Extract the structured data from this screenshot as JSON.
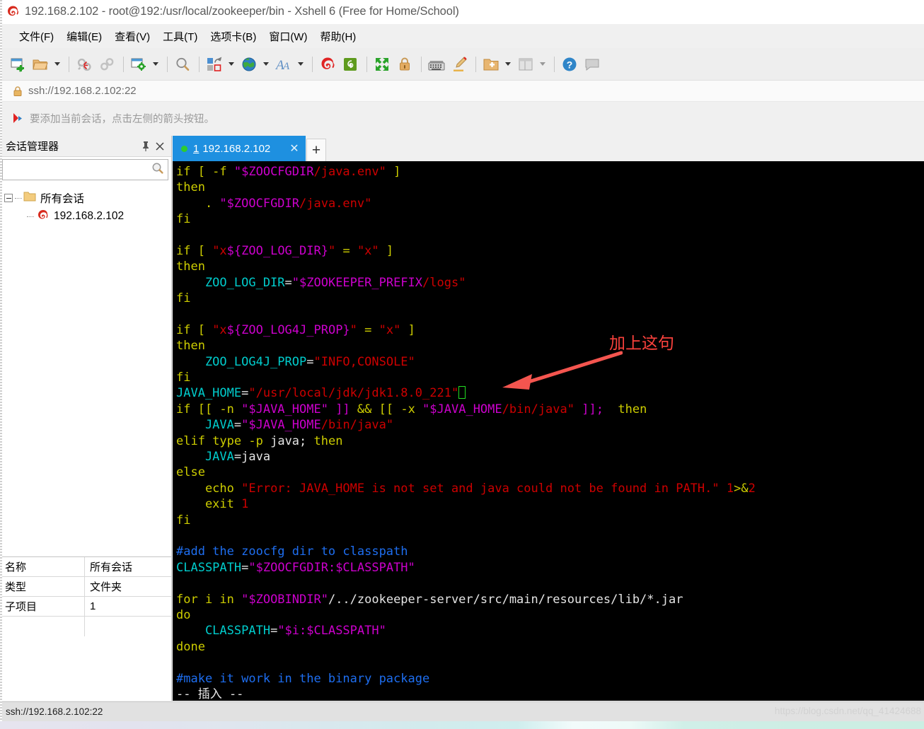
{
  "window": {
    "title": "192.168.2.102 - root@192:/usr/local/zookeeper/bin - Xshell 6 (Free for Home/School)",
    "app_icon": "xshell-logo-icon"
  },
  "menubar": {
    "items": [
      {
        "label": "文件(F)",
        "name": "menu-file"
      },
      {
        "label": "编辑(E)",
        "name": "menu-edit"
      },
      {
        "label": "查看(V)",
        "name": "menu-view"
      },
      {
        "label": "工具(T)",
        "name": "menu-tools"
      },
      {
        "label": "选项卡(B)",
        "name": "menu-tabs"
      },
      {
        "label": "窗口(W)",
        "name": "menu-window"
      },
      {
        "label": "帮助(H)",
        "name": "menu-help"
      }
    ]
  },
  "toolbar": {
    "buttons": [
      {
        "icon": "new-session-icon",
        "caret": false
      },
      {
        "icon": "open-folder-icon",
        "caret": true
      },
      {
        "sep": true
      },
      {
        "icon": "disconnect-icon",
        "caret": false
      },
      {
        "icon": "reconnect-link-icon",
        "caret": false
      },
      {
        "sep": true
      },
      {
        "icon": "session-properties-icon",
        "caret": true
      },
      {
        "sep": true
      },
      {
        "icon": "find-icon",
        "caret": false
      },
      {
        "sep": true
      },
      {
        "icon": "layout-arrange-icon",
        "caret": true
      },
      {
        "icon": "globe-icon",
        "caret": true
      },
      {
        "icon": "font-icon",
        "caret": true
      },
      {
        "sep": true
      },
      {
        "icon": "xshell-icon",
        "caret": false
      },
      {
        "icon": "xftp-icon",
        "caret": false
      },
      {
        "sep": true
      },
      {
        "icon": "fullscreen-icon",
        "caret": false
      },
      {
        "icon": "lock-icon",
        "caret": false
      },
      {
        "sep": true
      },
      {
        "icon": "keyboard-icon",
        "caret": false
      },
      {
        "icon": "highlight-pen-icon",
        "caret": false
      },
      {
        "sep": true
      },
      {
        "icon": "add-to-folder-icon",
        "caret": true
      },
      {
        "icon": "split-view-icon",
        "caret": true
      },
      {
        "sep": true
      },
      {
        "icon": "help-icon",
        "caret": false
      },
      {
        "icon": "comment-icon",
        "caret": false
      }
    ]
  },
  "addressbar": {
    "lock_icon": "padlock-icon",
    "url": "ssh://192.168.2.102:22"
  },
  "notice": {
    "icon": "red-arrow-flag-icon",
    "text": "要添加当前会话，点击左侧的箭头按钮。"
  },
  "sidebar": {
    "title": "会话管理器",
    "pin_icon": "pin-icon",
    "close_icon": "close-icon",
    "search": {
      "value": "",
      "placeholder": "",
      "icon": "search-icon"
    },
    "tree": {
      "root": {
        "label": "所有会话",
        "icon": "folder-icon",
        "expanded": true
      },
      "children": [
        {
          "label": "192.168.2.102",
          "icon": "xshell-session-icon"
        }
      ]
    },
    "properties": [
      {
        "key": "名称",
        "value": "所有会话"
      },
      {
        "key": "类型",
        "value": "文件夹"
      },
      {
        "key": "子项目",
        "value": "1"
      }
    ]
  },
  "tabs": {
    "items": [
      {
        "number": "1",
        "label": "192.168.2.102",
        "status_dot_color": "#2ecc2e",
        "close_label": "✕",
        "active": true
      }
    ],
    "new_tab_label": "+"
  },
  "terminal": {
    "mode_line": "-- 插入 --",
    "cursor": {
      "visible": true,
      "line_index": 15,
      "style": "green-box-outline"
    },
    "lines": [
      {
        "tokens": [
          {
            "t": "if [ -f ",
            "c": "yellow"
          },
          {
            "t": "\"$ZOOCFGDIR",
            "c": "magenta"
          },
          {
            "t": "/java.env\"",
            "c": "red"
          },
          {
            "t": " ]",
            "c": "yellow"
          }
        ]
      },
      {
        "tokens": [
          {
            "t": "then",
            "c": "yellow"
          }
        ]
      },
      {
        "tokens": [
          {
            "t": "    . ",
            "c": "yellow"
          },
          {
            "t": "\"$ZOOCFGDIR",
            "c": "magenta"
          },
          {
            "t": "/java.env\"",
            "c": "red"
          }
        ]
      },
      {
        "tokens": [
          {
            "t": "fi",
            "c": "yellow"
          }
        ]
      },
      {
        "tokens": [
          {
            "t": "",
            "c": "yellow"
          }
        ]
      },
      {
        "tokens": [
          {
            "t": "if [ ",
            "c": "yellow"
          },
          {
            "t": "\"x",
            "c": "red"
          },
          {
            "t": "${ZOO_LOG_DIR}",
            "c": "magenta"
          },
          {
            "t": "\"",
            "c": "red"
          },
          {
            "t": " = ",
            "c": "yellow"
          },
          {
            "t": "\"x\"",
            "c": "red"
          },
          {
            "t": " ]",
            "c": "yellow"
          }
        ]
      },
      {
        "tokens": [
          {
            "t": "then",
            "c": "yellow"
          }
        ]
      },
      {
        "tokens": [
          {
            "t": "    ZOO_LOG_DIR",
            "c": "cyan"
          },
          {
            "t": "=",
            "c": "white"
          },
          {
            "t": "\"$ZOOKEEPER_PREFIX",
            "c": "magenta"
          },
          {
            "t": "/logs\"",
            "c": "red"
          }
        ]
      },
      {
        "tokens": [
          {
            "t": "fi",
            "c": "yellow"
          }
        ]
      },
      {
        "tokens": [
          {
            "t": "",
            "c": "yellow"
          }
        ]
      },
      {
        "tokens": [
          {
            "t": "if [ ",
            "c": "yellow"
          },
          {
            "t": "\"x",
            "c": "red"
          },
          {
            "t": "${ZOO_LOG4J_PROP}",
            "c": "magenta"
          },
          {
            "t": "\"",
            "c": "red"
          },
          {
            "t": " = ",
            "c": "yellow"
          },
          {
            "t": "\"x\"",
            "c": "red"
          },
          {
            "t": " ]",
            "c": "yellow"
          }
        ]
      },
      {
        "tokens": [
          {
            "t": "then",
            "c": "yellow"
          }
        ]
      },
      {
        "tokens": [
          {
            "t": "    ZOO_LOG4J_PROP",
            "c": "cyan"
          },
          {
            "t": "=",
            "c": "white"
          },
          {
            "t": "\"INFO,CONSOLE\"",
            "c": "red"
          }
        ]
      },
      {
        "tokens": [
          {
            "t": "fi",
            "c": "yellow"
          }
        ]
      },
      {
        "tokens": [
          {
            "t": "JAVA_HOME",
            "c": "cyan"
          },
          {
            "t": "=",
            "c": "white"
          },
          {
            "t": "\"/usr/local/jdk/jdk1.8.0_221\"",
            "c": "red"
          },
          {
            "t": "CURSOR",
            "c": "cursor"
          }
        ]
      },
      {
        "tokens": [
          {
            "t": "if [[ -n ",
            "c": "yellow"
          },
          {
            "t": "\"$JAVA_HOME\"",
            "c": "magenta"
          },
          {
            "t": " ]] ",
            "c": "magenta"
          },
          {
            "t": "&&",
            "c": "yellow"
          },
          {
            "t": " [[ -x ",
            "c": "yellow"
          },
          {
            "t": "\"$JAVA_HOME",
            "c": "magenta"
          },
          {
            "t": "/bin/java\"",
            "c": "red"
          },
          {
            "t": " ]];",
            "c": "magenta"
          },
          {
            "t": "  then",
            "c": "yellow"
          }
        ]
      },
      {
        "tokens": [
          {
            "t": "    JAVA",
            "c": "cyan"
          },
          {
            "t": "=",
            "c": "white"
          },
          {
            "t": "\"$JAVA_HOME",
            "c": "magenta"
          },
          {
            "t": "/bin/java\"",
            "c": "red"
          }
        ]
      },
      {
        "tokens": [
          {
            "t": "elif ",
            "c": "yellow"
          },
          {
            "t": "type",
            "c": "yellow"
          },
          {
            "t": " -p ",
            "c": "yellow"
          },
          {
            "t": "java",
            "c": "white"
          },
          {
            "t": "; ",
            "c": "white"
          },
          {
            "t": "then",
            "c": "yellow"
          }
        ]
      },
      {
        "tokens": [
          {
            "t": "    JAVA",
            "c": "cyan"
          },
          {
            "t": "=java",
            "c": "white"
          }
        ]
      },
      {
        "tokens": [
          {
            "t": "else",
            "c": "yellow"
          }
        ]
      },
      {
        "tokens": [
          {
            "t": "    echo ",
            "c": "yellow"
          },
          {
            "t": "\"Error: JAVA_HOME is not set and java could not be found in PATH.\"",
            "c": "red"
          },
          {
            "t": " 1",
            "c": "red"
          },
          {
            "t": ">&",
            "c": "yellow"
          },
          {
            "t": "2",
            "c": "red"
          }
        ]
      },
      {
        "tokens": [
          {
            "t": "    exit ",
            "c": "yellow"
          },
          {
            "t": "1",
            "c": "red"
          }
        ]
      },
      {
        "tokens": [
          {
            "t": "fi",
            "c": "yellow"
          }
        ]
      },
      {
        "tokens": [
          {
            "t": "",
            "c": "yellow"
          }
        ]
      },
      {
        "tokens": [
          {
            "t": "#add the zoocfg dir to classpath",
            "c": "blue"
          }
        ]
      },
      {
        "tokens": [
          {
            "t": "CLASSPATH",
            "c": "cyan"
          },
          {
            "t": "=",
            "c": "white"
          },
          {
            "t": "\"$ZOOCFGDIR:$CLASSPATH\"",
            "c": "magenta"
          }
        ]
      },
      {
        "tokens": [
          {
            "t": "",
            "c": "yellow"
          }
        ]
      },
      {
        "tokens": [
          {
            "t": "for i in ",
            "c": "yellow"
          },
          {
            "t": "\"$ZOOBINDIR\"",
            "c": "magenta"
          },
          {
            "t": "/../zookeeper-server/src/main/resources/lib/*.jar",
            "c": "white"
          }
        ]
      },
      {
        "tokens": [
          {
            "t": "do",
            "c": "yellow"
          }
        ]
      },
      {
        "tokens": [
          {
            "t": "    CLASSPATH",
            "c": "cyan"
          },
          {
            "t": "=",
            "c": "white"
          },
          {
            "t": "\"$i:$CLASSPATH\"",
            "c": "magenta"
          }
        ]
      },
      {
        "tokens": [
          {
            "t": "done",
            "c": "yellow"
          }
        ]
      },
      {
        "tokens": [
          {
            "t": "",
            "c": "yellow"
          }
        ]
      },
      {
        "tokens": [
          {
            "t": "#make it work in the binary package",
            "c": "blue"
          }
        ]
      },
      {
        "tokens": [
          {
            "t": "-- 插入 --",
            "c": "white"
          }
        ]
      }
    ]
  },
  "annotation": {
    "text": "加上这句",
    "color": "#f9413c",
    "arrow": "red-arrow-pointing-left"
  },
  "statusbar": {
    "text": "ssh://192.168.2.102:22",
    "watermark": "https://blog.csdn.net/qq_41424688"
  }
}
